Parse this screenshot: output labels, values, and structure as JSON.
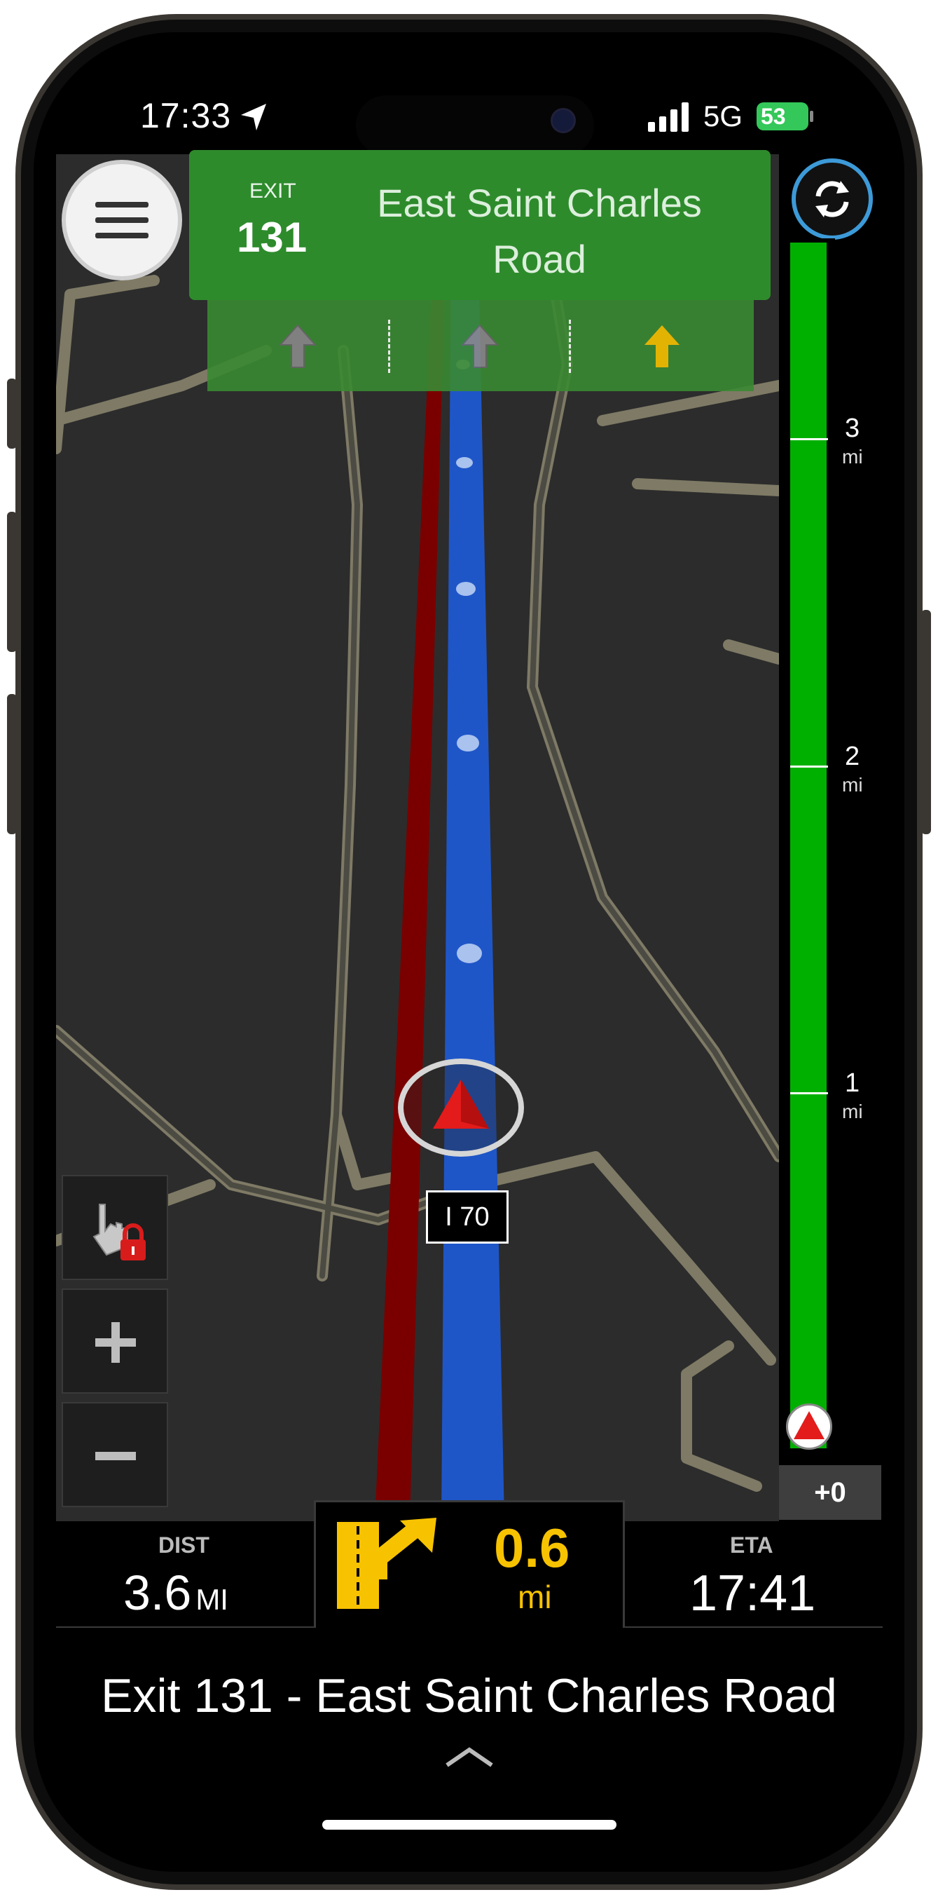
{
  "status_bar": {
    "time": "17:33",
    "network": "5G",
    "battery": "53"
  },
  "guidance_sign": {
    "exit_label": "EXIT",
    "exit_number": "131",
    "road_line1": "East Saint Charles",
    "road_line2": "Road"
  },
  "map": {
    "road_shield": "I 70"
  },
  "distance_scale": {
    "marks": [
      {
        "value": "3",
        "unit": "mi"
      },
      {
        "value": "2",
        "unit": "mi"
      },
      {
        "value": "1",
        "unit": "mi"
      }
    ],
    "delay": "+0"
  },
  "trip": {
    "dist_label": "DIST",
    "dist_value": "3.6",
    "dist_unit": "MI",
    "next_distance": "0.6",
    "next_unit": "mi",
    "eta_label": "ETA",
    "eta_value": "17:41"
  },
  "route": {
    "next_instruction": "Exit 131 - East Saint Charles Road"
  },
  "colors": {
    "sign_green": "#2e8b2c",
    "route_blue": "#1f56c7",
    "route_red": "#8a0000",
    "progress_green": "#00b000",
    "accent_yellow": "#f7c200"
  }
}
